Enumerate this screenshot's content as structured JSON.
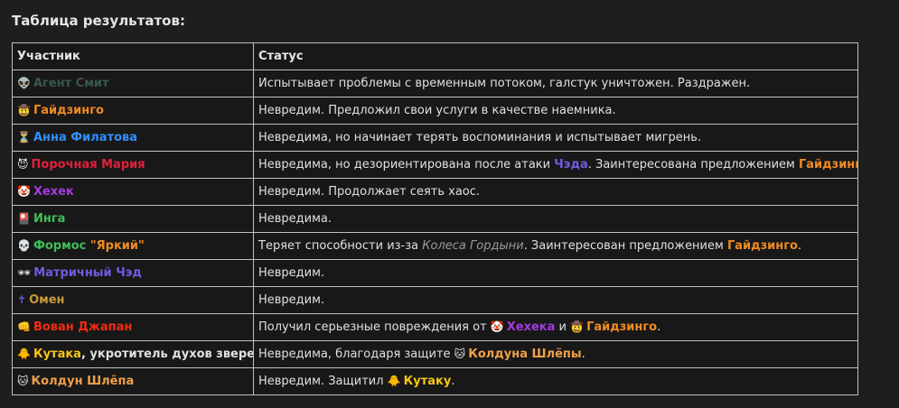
{
  "title": "Таблица результатов:",
  "headers": {
    "participant": "Участник",
    "status": "Статус"
  },
  "rows": {
    "r0": {
      "icon": "👽",
      "name": "Агент Смит",
      "status": "Испытывает проблемы с временным потоком, галстук уничтожен. Раздражен."
    },
    "r1": {
      "icon": "🤠",
      "name": "Гайдзинго",
      "status": "Невредим. Предложил свои услуги в качестве наемника."
    },
    "r2": {
      "icon": "⏳",
      "name": "Анна Филатова",
      "status": "Невредима, но начинает терять воспоминания и испытывает мигрень."
    },
    "r3": {
      "icon": "😈",
      "name": "Порочная Мария",
      "status_a": "Невредима, но дезориентирована после атаки ",
      "status_b": "Чэда",
      "status_c": ". Заинтересована предложением ",
      "status_d": "Гайдзинго",
      "status_e": "."
    },
    "r4": {
      "icon": "🤡",
      "name": "Хехек",
      "status": "Невредим. Продолжает сеять хаос."
    },
    "r5": {
      "icon": "🎴",
      "name": "Инга",
      "status": "Невредима."
    },
    "r6": {
      "icon": "💀",
      "name_a": "Формос ",
      "name_b": "\"Яркий\"",
      "status_a": "Теряет способности из-за ",
      "status_b": "Колеса Гордыни",
      "status_c": ". Заинтересован предложением ",
      "status_d": "Гайдзинго",
      "status_e": "."
    },
    "r7": {
      "icon": "🕶",
      "name": "Матричный Чэд",
      "status": "Невредим."
    },
    "r8": {
      "icon": "✝",
      "name": "Омен",
      "status": "Невредим."
    },
    "r9": {
      "icon": "👊",
      "name": "Вован Джапан",
      "status_a": "Получил серьезные повреждения от ",
      "icon_b": "🤡",
      "status_b": "Хехека",
      "status_c": " и ",
      "icon_d": "🤠",
      "status_d": "Гайдзинго",
      "status_e": "."
    },
    "r10": {
      "icon": "🐥",
      "name_a": "Кутака",
      "name_b": ", укротитель духов зверей",
      "status_a": "Невредима, благодаря защите ",
      "icon_b": "🐱",
      "status_b": "Колдуна Шлёпы",
      "status_c": "."
    },
    "r11": {
      "icon": "🐱",
      "name": "Колдун Шлёпа",
      "status_a": "Невредим. Защитил ",
      "icon_b": "🐥",
      "status_b": "Кутаку",
      "status_c": "."
    }
  }
}
